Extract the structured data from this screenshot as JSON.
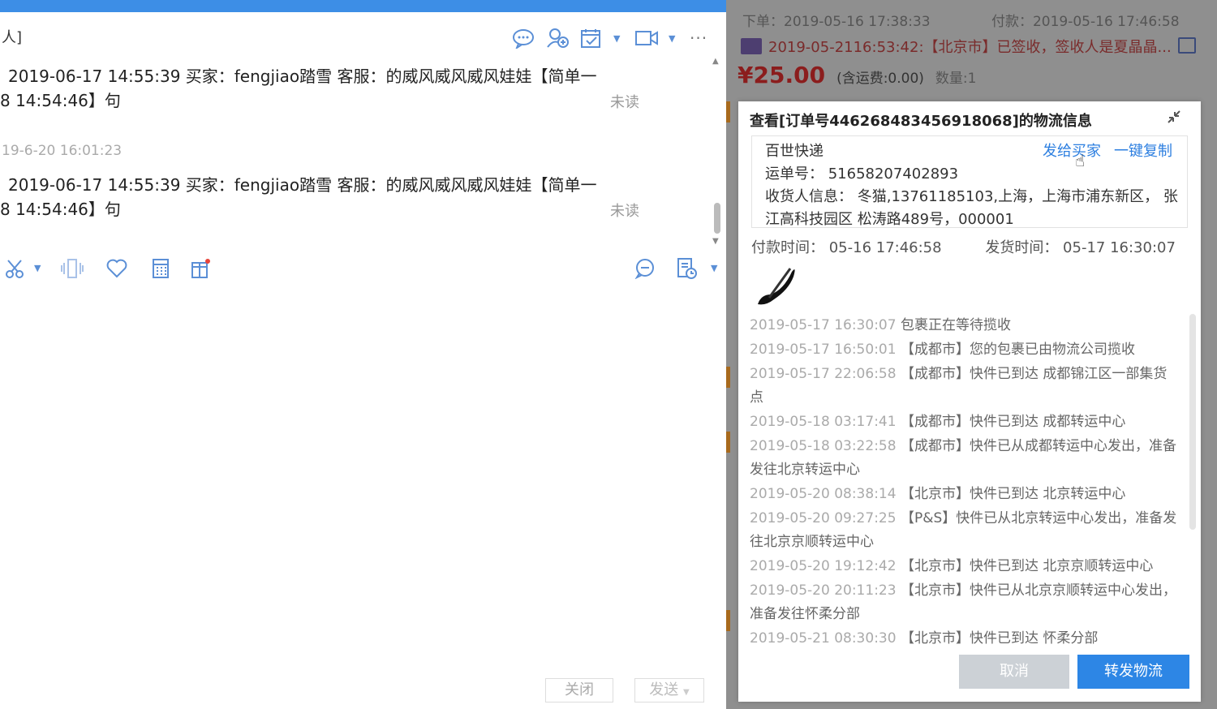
{
  "chat": {
    "header_title": "人]",
    "messages": [
      {
        "line1": "2019-06-17 14:55:39 买家：fengjiao踏雪  客服：的威风威风威风娃娃【简单一",
        "line2": "8 14:54:46】句",
        "status": "未读"
      },
      {
        "timestamp": "19-6-20 16:01:23",
        "line1": "2019-06-17 14:55:39 买家：fengjiao踏雪  客服：的威风威风威风娃娃【简单一",
        "line2": "8 14:54:46】句",
        "status": "未读"
      }
    ],
    "icons": {
      "header": [
        "chat-bubble-icon",
        "add-contact-icon",
        "schedule-icon",
        "video-icon",
        "more-icon"
      ],
      "toolbar": [
        "scissors-icon",
        "vibrate-icon",
        "heart-icon",
        "calculator-icon",
        "gift-box-icon",
        "emoji-chat-icon",
        "document-icon"
      ]
    },
    "close_label": "关闭",
    "send_label": "发送"
  },
  "order": {
    "order_time": "下单：2019-05-16 17:38:33",
    "pay_time": "付款：2019-05-16 17:46:58",
    "shipping_status": "2019-05-2116:53:42:【北京市】已签收，签收人是夏晶晶...",
    "price": "¥25.00",
    "shipping_fee": "(含运费:0.00)",
    "quantity": "数量:1"
  },
  "logistics_modal": {
    "title": "查看[订单号446268483456918068]的物流信息",
    "carrier": "百世快递",
    "send_to_buyer": "发给买家",
    "copy_all": "一键复制",
    "tracking_label": "运单号：  51658207402893",
    "receiver_line1": "收货人信息：  冬猫,13761185103,上海，上海市浦东新区， 张",
    "receiver_line2": "江高科技园区 松涛路489号，000001",
    "paid_time": "付款时间：  05-16 17:46:58",
    "ship_time": "发货时间：  05-17 16:30:07",
    "events": [
      {
        "time": "2019-05-17 16:30:07",
        "desc": "包裹正在等待揽收"
      },
      {
        "time": "2019-05-17 16:50:01",
        "desc": "【成都市】您的包裹已由物流公司揽收"
      },
      {
        "time": "2019-05-17 22:06:58",
        "desc": "【成都市】快件已到达 成都锦江区一部集货点"
      },
      {
        "time": "2019-05-18 03:17:41",
        "desc": "【成都市】快件已到达 成都转运中心"
      },
      {
        "time": "2019-05-18 03:22:58",
        "desc": "【成都市】快件已从成都转运中心发出，准备发往北京转运中心"
      },
      {
        "time": "2019-05-20 08:38:14",
        "desc": "【北京市】快件已到达 北京转运中心"
      },
      {
        "time": "2019-05-20 09:27:25",
        "desc": "【P&S】快件已从北京转运中心发出，准备发往北京京顺转运中心"
      },
      {
        "time": "2019-05-20 19:12:42",
        "desc": "【北京市】快件已到达 北京京顺转运中心"
      },
      {
        "time": "2019-05-20 20:11:23",
        "desc": "【北京市】快件已从北京京顺转运中心发出，准备发往怀柔分部"
      },
      {
        "time": "2019-05-21 08:30:30",
        "desc": "【北京市】快件已到达 怀柔分部"
      }
    ],
    "cancel_label": "取消",
    "forward_label": "转发物流"
  }
}
